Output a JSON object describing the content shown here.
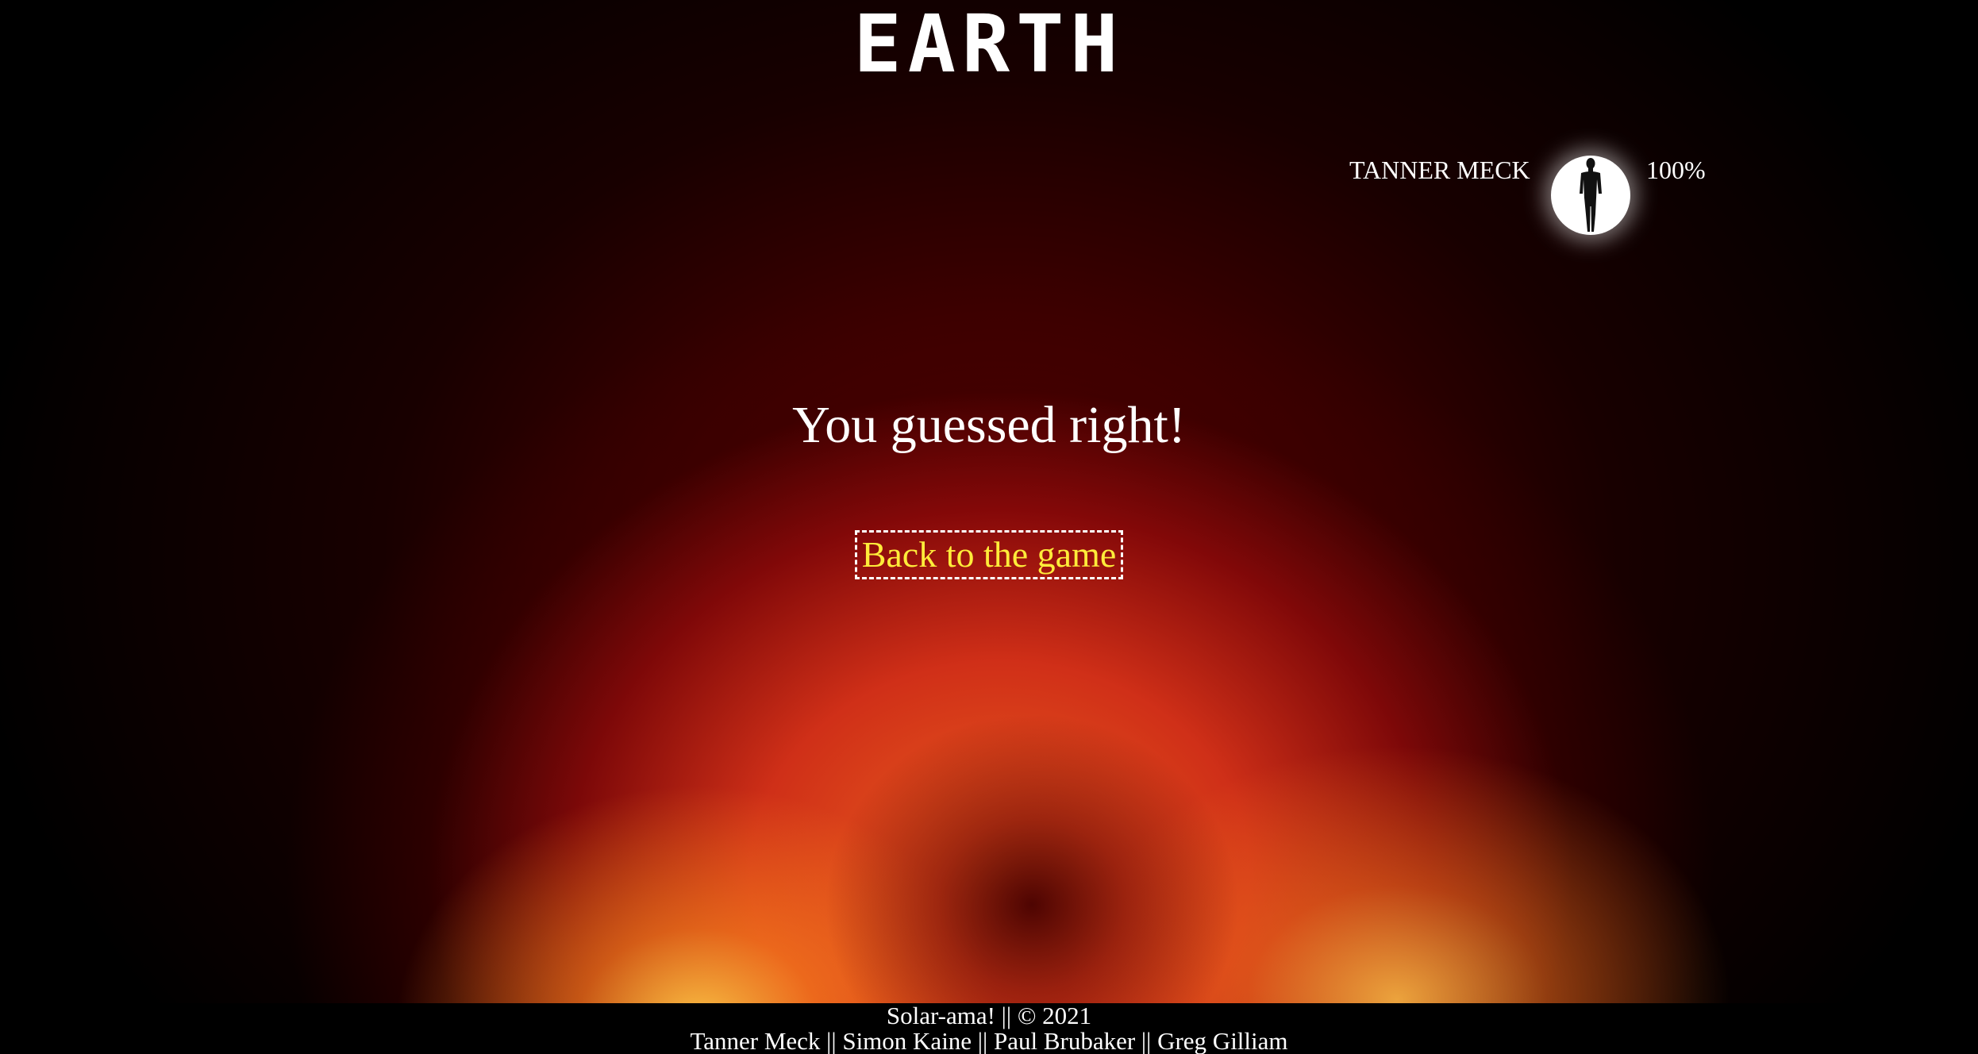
{
  "header": {
    "planet_name": "EARTH"
  },
  "player": {
    "name": "TANNER MECK",
    "avatar_icon": "human-silhouette-icon",
    "score": "100%"
  },
  "result": {
    "message": "You guessed right!",
    "back_link_label": "Back to the game"
  },
  "footer": {
    "line1": "Solar-ama! || © 2021",
    "line2": "Tanner Meck || Simon Kaine || Paul Brubaker || Greg Gilliam"
  },
  "colors": {
    "link": "#ffec3a",
    "text": "#ffffff",
    "background": "#000000"
  }
}
